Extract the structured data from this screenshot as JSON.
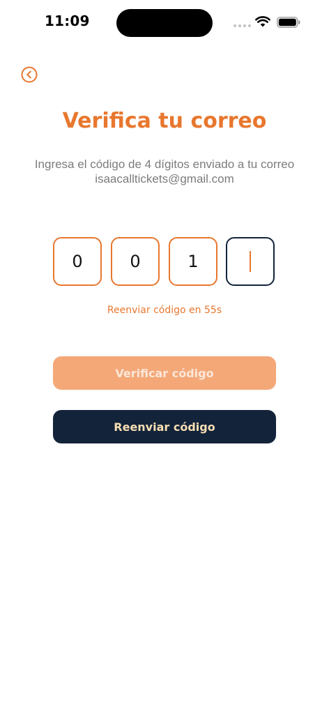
{
  "status_bar": {
    "time": "11:09"
  },
  "header": {
    "back_icon": "chevron-left-circle-icon",
    "title": "Verifica tu correo"
  },
  "instructions": {
    "line1": "Ingresa el código de 4 dígitos enviado a tu correo",
    "email": "isaacalltickets@gmail.com"
  },
  "code": {
    "digits": [
      "0",
      "0",
      "1",
      ""
    ],
    "active_index": 3
  },
  "resend_timer": "Reenviar código en 55s",
  "buttons": {
    "verify_label": "Verificar código",
    "resend_label": "Reenviar código"
  },
  "colors": {
    "accent": "#e8772e",
    "accent_disabled": "#f4a878",
    "dark": "#13233a",
    "secondary_text": "#7c7c7c",
    "resend_label_color": "#f7dfb3"
  }
}
